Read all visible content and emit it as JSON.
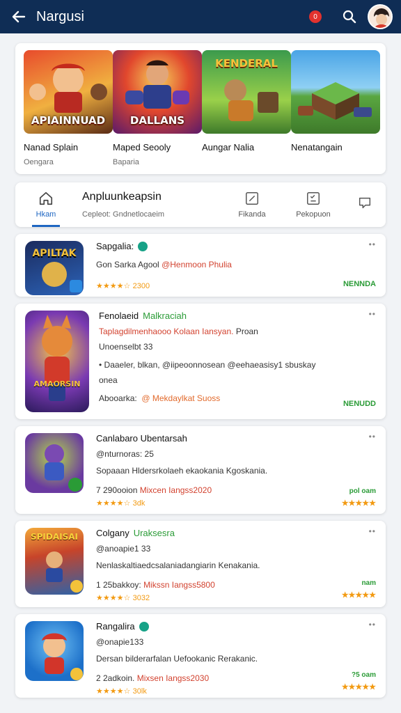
{
  "topbar": {
    "title": "Nargusi",
    "notification_count": "0"
  },
  "featured": [
    {
      "name": "Nanad Splain",
      "sub": "Oengara",
      "caption": "APIAINNUAD",
      "colors": [
        "#c9331f",
        "#f3a93a"
      ]
    },
    {
      "name": "Maped Seooly",
      "sub": "Baparia",
      "caption": "DALLANS",
      "colors": [
        "#7a1f6a",
        "#e28d2a"
      ]
    },
    {
      "name": "Aungar Nalia",
      "sub": "",
      "caption": "KENDERAL",
      "colors": [
        "#2d6a2f",
        "#b9c447"
      ]
    },
    {
      "name": "Nenatangain",
      "sub": "",
      "caption": "",
      "colors": [
        "#2f7fbf",
        "#5aa741"
      ]
    }
  ],
  "tabs": {
    "home": "Hkam",
    "group_title": "Anpluunkeapsin",
    "group_sub": "Cepleot: Gndnetlocaeim",
    "edit": "Fikanda",
    "list": "Pekopuon"
  },
  "apps": [
    {
      "name": "Sapgalia:",
      "line1": "Gon Sarka Agool",
      "line1_red": "@Henmoon Phulia",
      "rating": "★★★★☆",
      "rating_text": "2300",
      "tag": "NENNDA",
      "caption": "APILTAK",
      "colors": [
        "#1b2b5e",
        "#2c63b8"
      ]
    },
    {
      "name_black": "Fenolaeid",
      "name_green": "Malkraciah",
      "line1_red": "Taplagdilmenhaooo Kolaan Iansyan.",
      "line1_rest": "Proan",
      "line2": "Unoenselbt 33",
      "bullet": "Daaeler, blkan, @iipeoonnosean @eehaeasisy1 sbuskay",
      "line4": "onea",
      "assoc_label": "Abooarka:",
      "assoc_value": "@ Mekdaylkat Suoss",
      "tag": "NENUDD",
      "caption": "AMAORSIN",
      "colors": [
        "#4a2a8a",
        "#e07a2a"
      ]
    },
    {
      "name": "Canlabaro Ubentarsah",
      "line1": "@nturnoras: 25",
      "line2": "Sopaaan Hldersrkolaeh ekaokania Kgoskania.",
      "line3_prefix": "7 290ooion",
      "line3_red": "Mixcen Iangss2020",
      "rating": "★★★★☆",
      "rating_text": "3dk",
      "price_top": "pol oam",
      "stars_right": "★★★★★",
      "colors": [
        "#6a3aa0",
        "#7bc142"
      ]
    },
    {
      "name_black": "Colgany",
      "name_green": "Uraksesra",
      "line1": "@anoapie1 33",
      "line2": "Nenlaskaltiaedcsalaniadangiarin Kenakania.",
      "line3_prefix": "1 25bakkoy:",
      "line3_red": "Mikssn Iangss5800",
      "rating": "★★★★☆",
      "rating_text": "3032",
      "price_top": "nam",
      "stars_right": "★★★★★",
      "caption": "SPIDAISAI",
      "colors": [
        "#c7442a",
        "#2e62a8"
      ]
    },
    {
      "name": "Rangalira",
      "line1": "@onapie133",
      "line2": "Dersan bilderarfalan Uefookanic Rerakanic.",
      "line3_prefix": "2 2adkoin.",
      "line3_red": "Mixsen Iangss2030",
      "rating": "★★★★☆",
      "rating_text": "30lk",
      "price_top": "?5 oam",
      "stars_right": "★★★★★",
      "colors": [
        "#1d70c9",
        "#f1a236"
      ]
    }
  ]
}
